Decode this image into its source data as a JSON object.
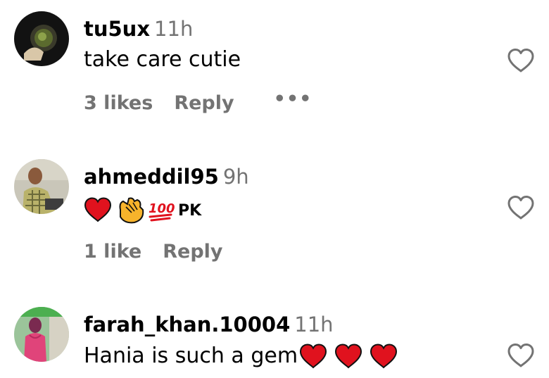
{
  "comments": [
    {
      "username": "tu5ux",
      "time": "11h",
      "text": "take care cutie",
      "likes": "3 likes",
      "reply": "Reply",
      "more": "•••"
    },
    {
      "username": "ahmeddil95",
      "time": "9h",
      "emojis": [
        "red-heart",
        "clapping-hands",
        "hundred-points"
      ],
      "text": "PK",
      "likes": "1 like",
      "reply": "Reply"
    },
    {
      "username": "farah_khan.10004",
      "time": "11h",
      "text": "Hania is such a gem",
      "emojis": [
        "red-heart",
        "red-heart",
        "red-heart"
      ]
    }
  ],
  "icons": {
    "like": "heart-outline-icon"
  },
  "colors": {
    "secondary_text": "#737373",
    "emoji_red": "#e0121e"
  }
}
